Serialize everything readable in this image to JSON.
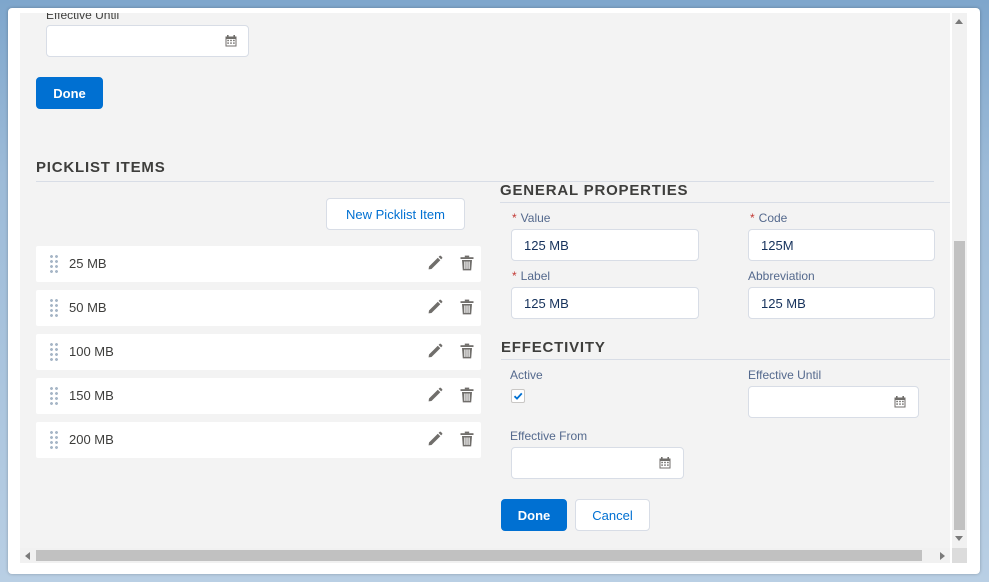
{
  "top": {
    "effective_until_label": "Effective Until",
    "done_label": "Done"
  },
  "picklist": {
    "title": "PICKLIST ITEMS",
    "new_button": "New Picklist Item",
    "items": [
      {
        "label": "25 MB"
      },
      {
        "label": "50 MB"
      },
      {
        "label": "100 MB"
      },
      {
        "label": "150 MB"
      },
      {
        "label": "200 MB"
      }
    ]
  },
  "general": {
    "title": "GENERAL PROPERTIES",
    "required_mark": "*",
    "value_label": "Value",
    "value": "125 MB",
    "code_label": "Code",
    "code": "125M",
    "label_label": "Label",
    "label_value": "125 MB",
    "abbreviation_label": "Abbreviation",
    "abbreviation": "125 MB"
  },
  "effectivity": {
    "title": "EFFECTIVITY",
    "active_label": "Active",
    "active_checked": true,
    "effective_until_label": "Effective Until",
    "effective_until_value": "",
    "effective_from_label": "Effective From",
    "effective_from_value": ""
  },
  "footer": {
    "done_label": "Done",
    "cancel_label": "Cancel"
  },
  "colors": {
    "brand": "#0070d2",
    "required": "#c23934",
    "panel_background": "#f3f3f3"
  }
}
